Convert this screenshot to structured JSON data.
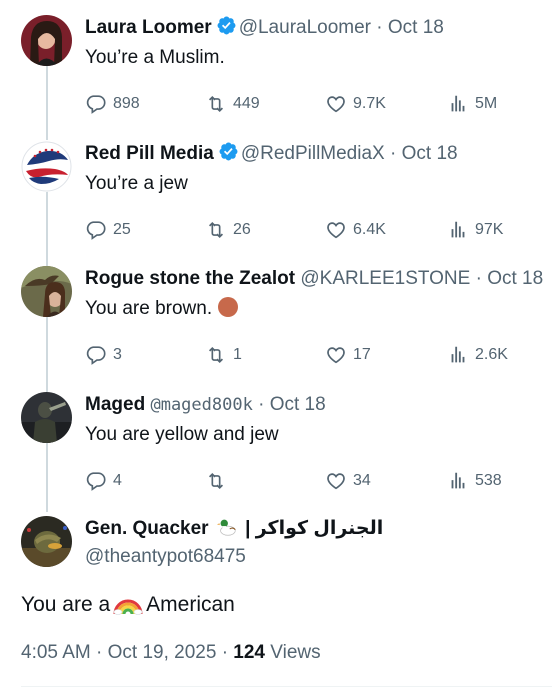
{
  "replies": [
    {
      "name": "Laura Loomer",
      "verified": true,
      "handle": "@LauraLoomer",
      "separator": "·",
      "date": "Oct 18",
      "text": "You’re a Muslim.",
      "replies": "898",
      "reposts": "449",
      "likes": "9.7K",
      "views": "5M"
    },
    {
      "name": "Red Pill Media",
      "verified": true,
      "handle": "@RedPillMediaX",
      "separator": "·",
      "date": "Oct 18",
      "text": "You’re a jew",
      "replies": "25",
      "reposts": "26",
      "likes": "6.4K",
      "views": "97K"
    },
    {
      "name": "Rogue stone the Zealot",
      "verified": false,
      "handle": "@KARLEE1STONE",
      "separator": "·",
      "date": "Oct 18",
      "text": "You are brown.",
      "emoji": "brown-circle",
      "replies": "3",
      "reposts": "1",
      "likes": "17",
      "views": "2.6K"
    },
    {
      "name": "Maged",
      "verified": false,
      "handle": "@maged800k",
      "separator": "·",
      "date": "Oct 18",
      "text": "You are yellow and jew",
      "replies": "4",
      "reposts": "",
      "likes": "34",
      "views": "538"
    }
  ],
  "main_post": {
    "name": "Gen. Quacker",
    "name_suffix": "| الجنرال كواكر",
    "handle": "@theantypot68475",
    "text_before": "You are a",
    "emoji": "rainbow",
    "text_after": "American",
    "time": "4:05 AM",
    "separator": "·",
    "date": "Oct 19, 2025",
    "views_count": "124",
    "views_label": "Views"
  },
  "colors": {
    "text": "#0f1419",
    "muted": "#536471",
    "verified": "#1d9bf0",
    "thread_line": "#cfd9de"
  }
}
